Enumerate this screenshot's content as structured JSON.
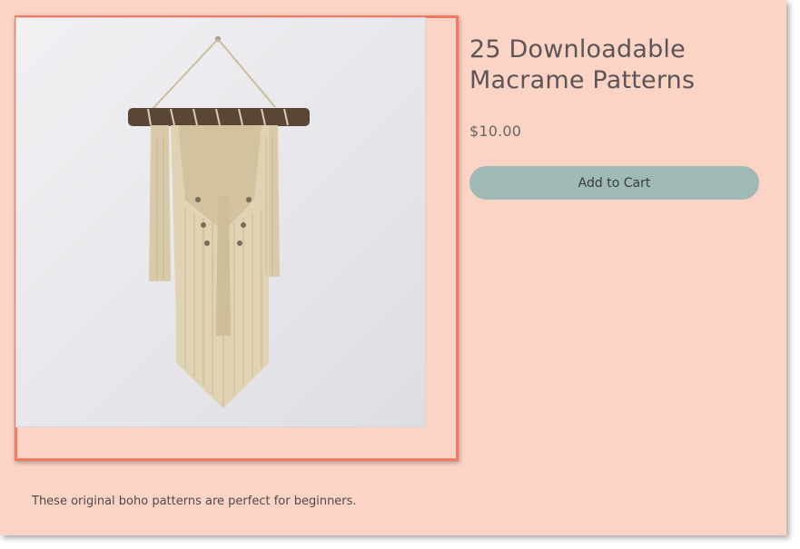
{
  "product": {
    "title": "25 Downloadable Macrame Patterns",
    "price": "$10.00",
    "add_to_cart_label": "Add to Cart",
    "description": "These original boho patterns are perfect for beginners."
  },
  "colors": {
    "page_background": "#fcd4c5",
    "highlight_border": "#f27a63",
    "button_background": "#9fb9b6",
    "text": "#5b5557"
  }
}
